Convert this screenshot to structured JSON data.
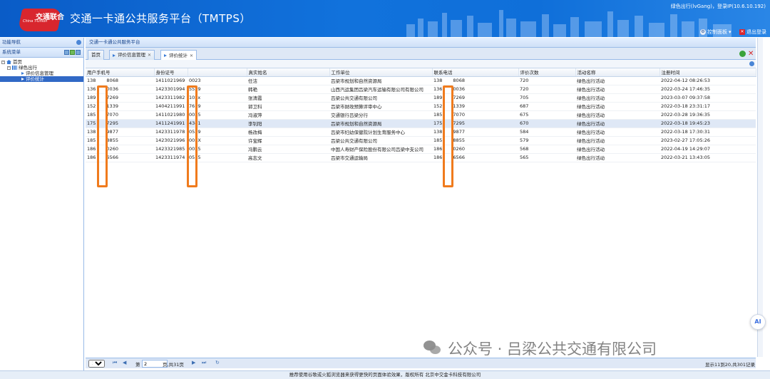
{
  "header": {
    "logo_text": "交通联合",
    "logo_sub": "China T-Union",
    "title": "交通一卡通公共服务平台（TMTPS）",
    "user_info": "绿色出行(lvGang)，登录IP(10.6.10.192)",
    "control_panel": "控制面板",
    "logout": "退出登录"
  },
  "leftnav": {
    "title": "功能导航",
    "system_menu": "系统菜单",
    "tree": [
      {
        "label": "首页",
        "level": 0,
        "icon": "home-icon"
      },
      {
        "label": "绿色出行",
        "level": 1,
        "icon": "grid-icon"
      },
      {
        "label": "评价信息管理",
        "level": 2,
        "icon": "arrow-right-icon"
      },
      {
        "label": "评价统计",
        "level": 2,
        "icon": "arrow-right-icon",
        "selected": true
      }
    ]
  },
  "content": {
    "title": "交通一卡通公共服务平台",
    "tabs": [
      {
        "label": "首页"
      },
      {
        "label": "评价信息管理"
      },
      {
        "label": "评价统计",
        "active": true
      }
    ]
  },
  "table": {
    "columns": [
      "用户手机号",
      "身份证号",
      "",
      "真实姓名",
      "工作单位",
      "联系电话",
      "评价次数",
      "活动名称",
      "注册时间"
    ],
    "rows": [
      [
        "138",
        "8068",
        "1411021969",
        "0023",
        "任洁",
        "吕梁市规划和自然资源局",
        "138",
        "8068",
        "720",
        "绿色出行活动",
        "2022-04-12 08:26:53"
      ],
      [
        "136",
        "0036",
        "1423301994",
        "5529",
        "韩艳",
        "山西汽运集团吕梁汽车运输有限公司有限公司",
        "136",
        "0036",
        "720",
        "绿色出行活动",
        "2022-03-24 17:46:35"
      ],
      [
        "189",
        "7269",
        "1423311982",
        "102x",
        "张清霞",
        "吕梁公共交通有限公司",
        "189",
        "7269",
        "705",
        "绿色出行活动",
        "2023-03-07 09:37:58"
      ],
      [
        "152",
        "1339",
        "1404211991",
        "7619",
        "郭卫科",
        "吕梁市财政预算评审中心",
        "152",
        "1339",
        "687",
        "绿色出行活动",
        "2022-03-18 23:31:17"
      ],
      [
        "185",
        "7070",
        "1411021980",
        "0025",
        "冯淑萍",
        "交通银行吕梁分行",
        "185",
        "7070",
        "675",
        "绿色出行活动",
        "2022-03-28 19:36:35"
      ],
      [
        "175",
        "7295",
        "1411241991",
        "4341",
        "李钊阳",
        "吕梁市规划和自然资源局",
        "175",
        "7295",
        "670",
        "绿色出行活动",
        "2022-03-18 19:45:23"
      ],
      [
        "138",
        "9877",
        "1423311978",
        "0529",
        "杨改梅",
        "吕梁市妇幼保健院计划生育服务中心",
        "138",
        "9877",
        "584",
        "绿色出行活动",
        "2022-03-18 17:30:31"
      ],
      [
        "185",
        "8855",
        "1423021996",
        "005X",
        "许宝辉",
        "吕梁公共交通有限公司",
        "185",
        "8855",
        "579",
        "绿色出行活动",
        "2023-02-27 17:05:26"
      ],
      [
        "186",
        "0260",
        "1423321985",
        "0025",
        "冯鹏云",
        "中国人寿财产保险股份有限公司吕梁中支公司",
        "186",
        "0260",
        "568",
        "绿色出行活动",
        "2022-04-19 14:29:07"
      ],
      [
        "186",
        "6566",
        "1423311974",
        "0515",
        "高志文",
        "吕梁市交通运输局",
        "186",
        "6566",
        "565",
        "绿色出行活动",
        "2022-03-21 13:43:05"
      ]
    ]
  },
  "pager": {
    "page_size": "10",
    "page_label": "第",
    "page_value": "2",
    "total_pages": "页,共31页",
    "info": "显示11到20,共301记录"
  },
  "footer": "推荐使用谷歌或火狐浏览器来获得更快的页面体验效果，版权所有 北京中交金卡科技有限公司",
  "watermark": "公众号 · 吕梁公共交通有限公司",
  "ai_badge": "AI",
  "colors": {
    "header_blue": "#0f6fd9",
    "mask_orange": "#f07b1d",
    "selected_blue": "#3169c6"
  }
}
